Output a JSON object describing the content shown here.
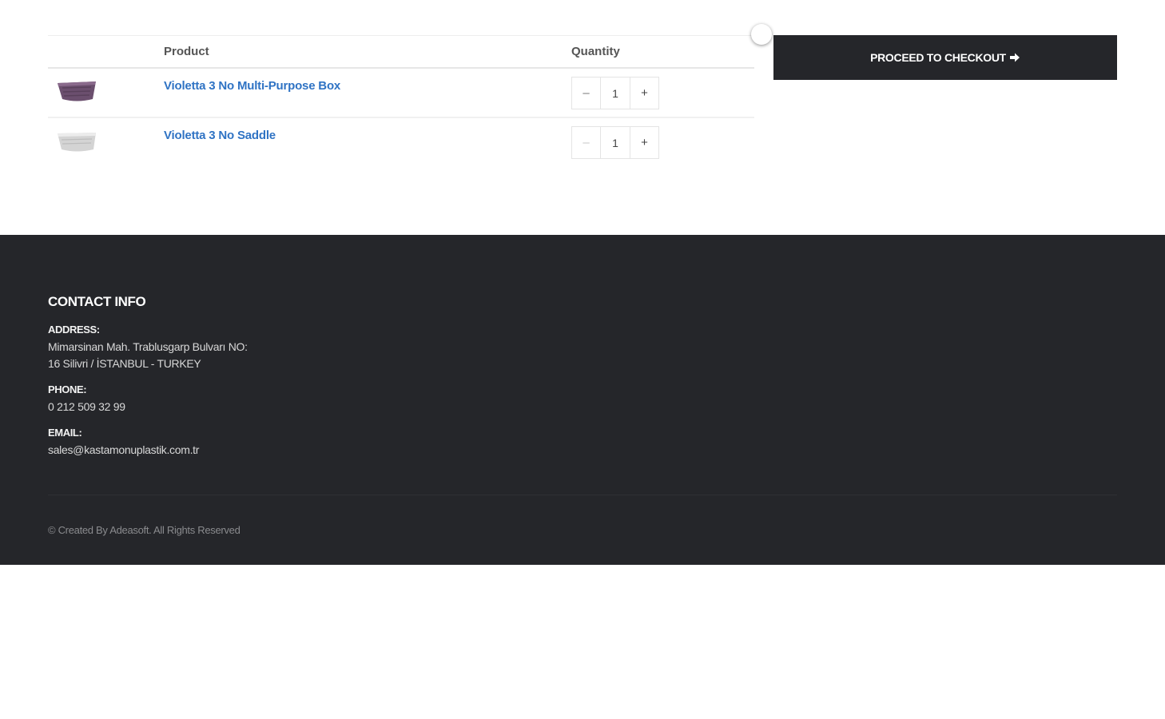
{
  "cart": {
    "columns": {
      "product": "Product",
      "quantity": "Quantity"
    },
    "items": [
      {
        "name": "Violetta 3 No Multi-Purpose Box",
        "quantity": "1",
        "thumb_color": "#6b4f6e"
      },
      {
        "name": "Violetta 3 No Saddle",
        "quantity": "1",
        "thumb_color": "#d4d4d4"
      }
    ],
    "decrement_symbol": "–",
    "increment_symbol": "+",
    "checkout_label": "PROCEED TO CHECKOUT",
    "checkout_icon": "arrow-right-icon"
  },
  "footer": {
    "heading": "CONTACT INFO",
    "address_label": "ADDRESS:",
    "address_line1": "Mimarsinan Mah. Trablusgarp Bulvarı NO:",
    "address_line2": "16 Silivri / İSTANBUL - TURKEY",
    "phone_label": "PHONE:",
    "phone": "0 212 509 32 99",
    "email_label": "EMAIL:",
    "email": "sales@kastamonuplastik.com.tr",
    "copyright": "© Created By Adeasoft. All Rights Reserved"
  },
  "colors": {
    "link": "#2f73c4",
    "dark": "#25262a",
    "white": "#ffffff"
  }
}
